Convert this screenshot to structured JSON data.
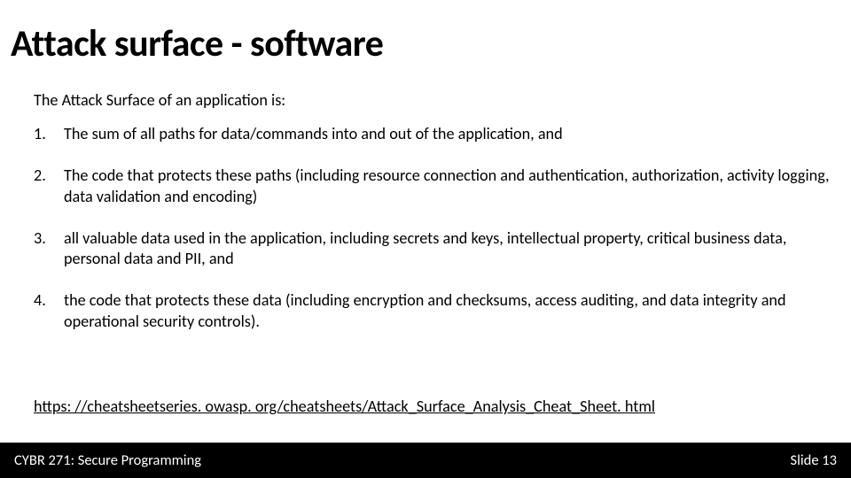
{
  "title": "Attack surface - software",
  "intro": "The Attack Surface of an application is:",
  "items": [
    {
      "n": "1.",
      "t": "The sum of all paths for data/commands into and out of the application, and"
    },
    {
      "n": "2.",
      "t": "The code that protects these paths (including resource connection and authentication, authorization, activity logging, data validation and encoding)"
    },
    {
      "n": "3.",
      "t": "all valuable data used in the application, including secrets and keys, intellectual property, critical business data, personal data and PII, and"
    },
    {
      "n": "4.",
      "t": "the code that protects these data (including encryption and checksums, access auditing, and data integrity and operational security controls)."
    }
  ],
  "link": "https: //cheatsheetseries. owasp. org/cheatsheets/Attack_Surface_Analysis_Cheat_Sheet. html",
  "footer": {
    "course": "CYBR 271: Secure Programming",
    "slide": "Slide 13"
  }
}
